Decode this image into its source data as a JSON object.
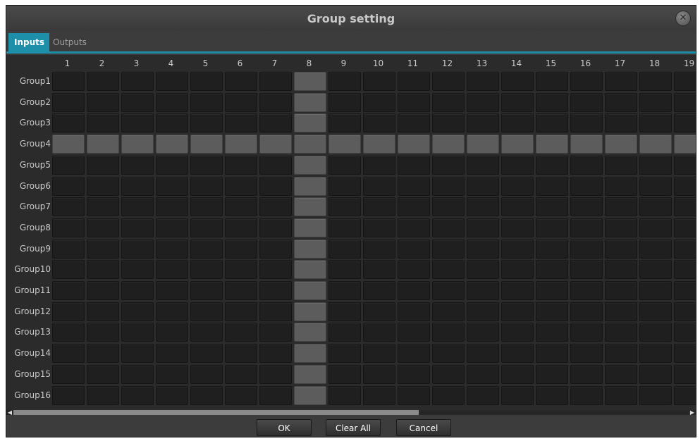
{
  "window": {
    "title": "Group setting"
  },
  "tabs": [
    {
      "label": "Inputs",
      "active": true
    },
    {
      "label": "Outputs",
      "active": false
    }
  ],
  "matrix": {
    "columns": [
      "1",
      "2",
      "3",
      "4",
      "5",
      "6",
      "7",
      "8",
      "9",
      "10",
      "11",
      "12",
      "13",
      "14",
      "15",
      "16",
      "17",
      "18",
      "19"
    ],
    "rows": [
      "Group1",
      "Group2",
      "Group3",
      "Group4",
      "Group5",
      "Group6",
      "Group7",
      "Group8",
      "Group9",
      "Group10",
      "Group11",
      "Group12",
      "Group13",
      "Group14",
      "Group15",
      "Group16"
    ],
    "selected_row": "Group4",
    "selected_column": "8"
  },
  "buttons": {
    "ok": "OK",
    "clear_all": "Clear All",
    "cancel": "Cancel"
  },
  "colors": {
    "accent": "#1e8fa8",
    "cell_off": "#1f1f1f",
    "cell_on": "#5c5c5c"
  }
}
